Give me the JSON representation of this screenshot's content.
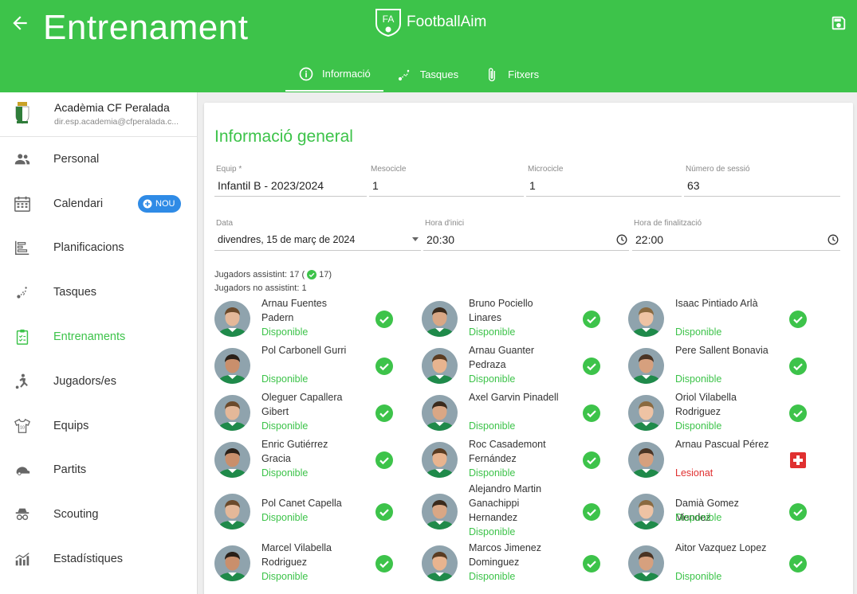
{
  "header": {
    "title": "Entrenament",
    "brand_name": "FootballAim",
    "brand_logo_text": "FA",
    "accent_color": "#3dc34a",
    "tabs": [
      {
        "label": "Informació",
        "icon": "info-icon",
        "active": true
      },
      {
        "label": "Tasques",
        "icon": "drill-icon",
        "active": false
      },
      {
        "label": "Fitxers",
        "icon": "paperclip-icon",
        "active": false
      }
    ]
  },
  "sidebar": {
    "org_name": "Acadèmia CF Peralada",
    "org_email": "dir.esp.academia@cfperalada.c...",
    "items": [
      {
        "label": "Personal",
        "icon": "people-icon"
      },
      {
        "label": "Calendari",
        "icon": "calendar-icon",
        "badge": "NOU"
      },
      {
        "label": "Planificacions",
        "icon": "planning-icon"
      },
      {
        "label": "Tasques",
        "icon": "drill-icon"
      },
      {
        "label": "Entrenaments",
        "icon": "clipboard-icon",
        "active": true
      },
      {
        "label": "Jugadors/es",
        "icon": "player-kick-icon"
      },
      {
        "label": "Equips",
        "icon": "jersey-icon"
      },
      {
        "label": "Partits",
        "icon": "match-icon"
      },
      {
        "label": "Scouting",
        "icon": "spy-icon"
      },
      {
        "label": "Estadístiques",
        "icon": "stats-icon"
      }
    ]
  },
  "main": {
    "section_title": "Informació general",
    "fields": {
      "equip": {
        "label": "Equip *",
        "value": "Infantil B - 2023/2024"
      },
      "mesocicle": {
        "label": "Mesocicle",
        "value": "1"
      },
      "microcicle": {
        "label": "Microcicle",
        "value": "1"
      },
      "sessio": {
        "label": "Número de sessió",
        "value": "63"
      },
      "data": {
        "label": "Data",
        "value": "divendres, 15 de març de 2024"
      },
      "hora_inici": {
        "label": "Hora d'inici",
        "value": "20:30"
      },
      "hora_fi": {
        "label": "Hora de finalització",
        "value": "22:00"
      }
    },
    "attendance": {
      "assistint_prefix": "Jugadors assistint: 17 (",
      "assistint_count": "17)",
      "no_assistint": "Jugadors no assistint: 1"
    },
    "players": [
      {
        "name": "Arnau Fuentes Padern",
        "status": "Disponible",
        "state": "ok"
      },
      {
        "name": "Bruno Pociello Linares",
        "status": "Disponible",
        "state": "ok"
      },
      {
        "name": "Isaac Pintiado Arlà",
        "status": "Disponible",
        "state": "ok"
      },
      {
        "name": "Pol Carbonell Gurri",
        "status": "Disponible",
        "state": "ok"
      },
      {
        "name": "Arnau Guanter Pedraza",
        "status": "Disponible",
        "state": "ok"
      },
      {
        "name": "Pere Sallent Bonavia",
        "status": "Disponible",
        "state": "ok"
      },
      {
        "name": "Oleguer Capallera Gibert",
        "status": "Disponible",
        "state": "ok"
      },
      {
        "name": "Axel Garvin Pinadell",
        "status": "Disponible",
        "state": "ok"
      },
      {
        "name": "Oriol Vilabella Rodriguez",
        "status": "Disponible",
        "state": "ok"
      },
      {
        "name": "Enric Gutiérrez Gracia",
        "status": "Disponible",
        "state": "ok"
      },
      {
        "name": "Roc Casademont Fernández",
        "status": "Disponible",
        "state": "ok"
      },
      {
        "name": "Arnau Pascual Pérez",
        "status": "Lesionat",
        "state": "injured"
      },
      {
        "name": "Pol Canet Capella",
        "status": "Disponible",
        "state": "ok"
      },
      {
        "name": "Alejandro Martin Ganachippi Hernandez",
        "status": "Disponible",
        "state": "ok"
      },
      {
        "name": "Damià Gomez Mendez",
        "status": "Disponible",
        "state": "ok"
      },
      {
        "name": "Marcel Vilabella Rodriguez",
        "status": "Disponible",
        "state": "ok"
      },
      {
        "name": "Marcos Jimenez Dominguez",
        "status": "Disponible",
        "state": "ok"
      },
      {
        "name": "Aitor Vazquez Lopez",
        "status": "Disponible",
        "state": "ok"
      }
    ]
  }
}
